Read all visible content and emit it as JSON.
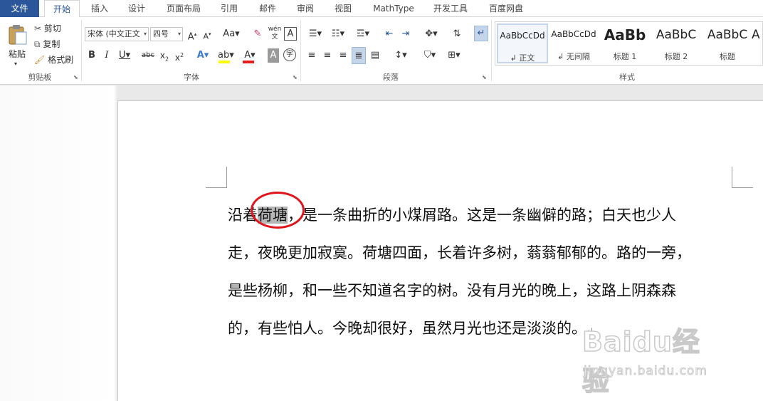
{
  "tabs": {
    "file": "文件",
    "items": [
      "开始",
      "插入",
      "设计",
      "页面布局",
      "引用",
      "邮件",
      "审阅",
      "视图",
      "MathType",
      "开发工具",
      "百度网盘"
    ]
  },
  "clipboard": {
    "paste": "粘贴",
    "cut": "剪切",
    "copy": "复制",
    "format_painter": "格式刷",
    "group": "剪贴板"
  },
  "font": {
    "name": "宋体 (中文正文",
    "size": "四号",
    "group": "字体"
  },
  "paragraph": {
    "group": "段落"
  },
  "styles": {
    "group": "样式",
    "items": [
      {
        "sample": "AaBbCcDd",
        "name": "↲ 正文"
      },
      {
        "sample": "AaBbCcDd",
        "name": "↲ 无间隔"
      },
      {
        "sample": "AaBb",
        "name": "标题 1"
      },
      {
        "sample": "AaBbC",
        "name": "标题 2"
      },
      {
        "sample": "AaBbC",
        "name": "标题"
      },
      {
        "sample": "A",
        "name": ""
      }
    ]
  },
  "document": {
    "line1_before": "沿着",
    "line1_selected": "荷塘",
    "line1_after": "，是一条曲折的小煤屑路。这是一条幽僻的路；白天也少人",
    "line2": "走，夜晚更加寂寞。荷塘四面，长着许多树，蓊蓊郁郁的。路的一旁，",
    "line3": "是些杨柳，和一些不知道名字的树。没有月光的晚上，这路上阴森森",
    "line4": "的，有些怕人。今晚却很好，虽然月光也还是淡淡的。",
    "pilcrow": "↵"
  },
  "watermark": {
    "logo": "Baidu经验",
    "url": "jingyan.baidu.com"
  },
  "colors": {
    "accent": "#2b579a",
    "annotation": "#e0141c",
    "highlight_bar": "#ffff00",
    "font_color_bar": "#e81c1c"
  }
}
